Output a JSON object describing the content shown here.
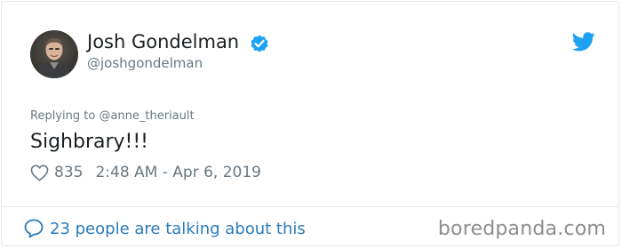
{
  "author": {
    "display_name": "Josh Gondelman",
    "handle": "@joshgondelman",
    "verified_icon": "verified-badge-icon",
    "avatar": "avatar"
  },
  "brand_icon": "twitter-bird-icon",
  "tweet": {
    "replying_prefix": "Replying to",
    "replying_to": "@anne_theriault",
    "text": "Sighbrary!!!",
    "like_count": "835",
    "timestamp": "2:48 AM - Apr 6, 2019"
  },
  "footer": {
    "talking_label": "23 people are talking about this"
  },
  "watermark": "boredpanda.com",
  "colors": {
    "twitter_blue": "#1da1f2",
    "link_blue": "#2b7bb9",
    "secondary_text": "#697882",
    "primary_text": "#1c2022",
    "border": "#e1e8ed"
  }
}
